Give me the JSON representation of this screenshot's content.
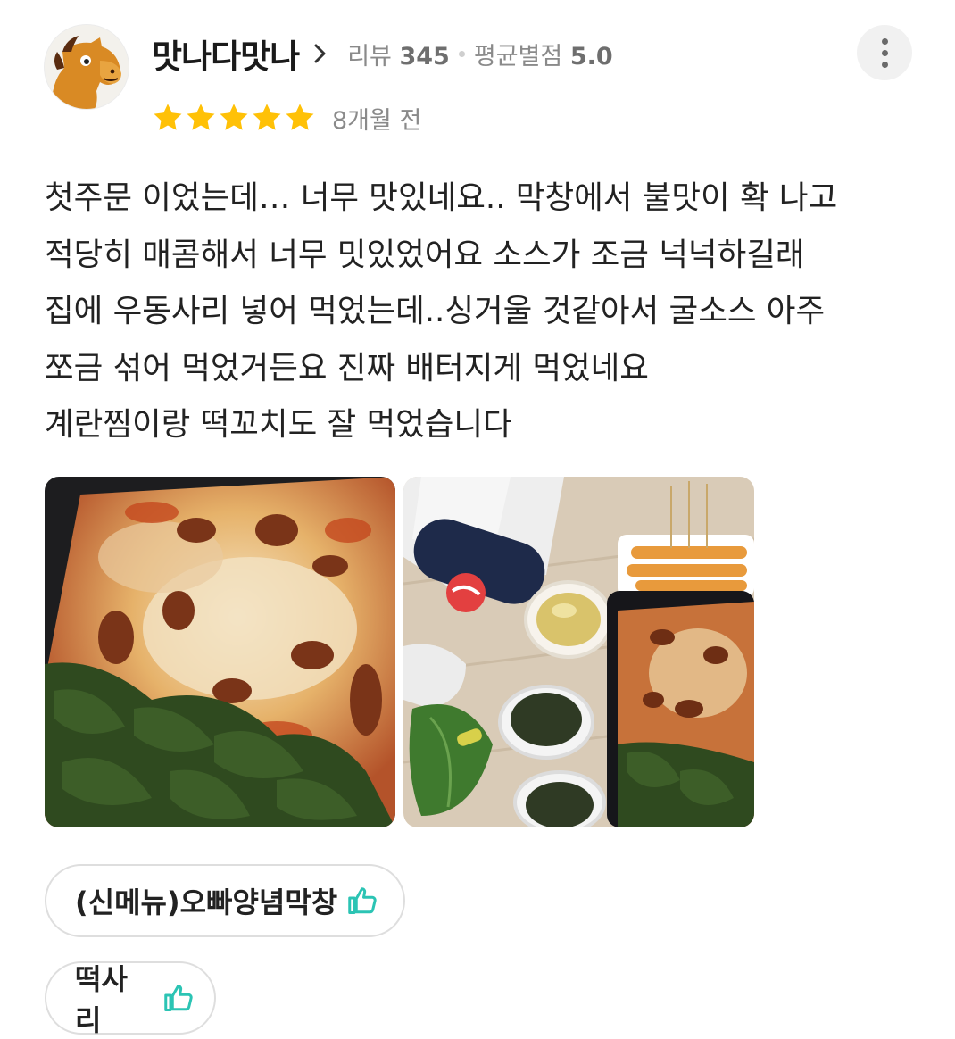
{
  "author": {
    "name": "맛나다맛나",
    "avatar_icon": "horse-avatar-icon",
    "review_count_label": "리뷰",
    "review_count": "345",
    "avg_rating_label": "평균별점",
    "avg_rating": "5.0"
  },
  "more_icon": "more-vertical-icon",
  "review": {
    "rating": 5,
    "max_rating": 5,
    "star_color": "#FFC107",
    "date": "8개월 전",
    "lines": [
      "첫주문 이었는데… 너무 맛있네요.. 막창에서 불맛이 확 나고",
      "적당히 매콤해서 너무 밋있었어요 소스가 조금 넉넉하길래",
      "집에 우동사리 넣어 먹었는데..싱거울 것같아서 굴소스 아주",
      "쪼금 섞어 먹었거든요 진짜 배터지게 먹었네요",
      "계란찜이랑 떡꼬치도 잘 먹었습니다"
    ]
  },
  "photos": [
    {
      "subject": "grilled-makchang-with-cheese-photo"
    },
    {
      "subject": "delivery-meal-spread-photo"
    }
  ],
  "menu_tags": [
    {
      "label": "(신메뉴)오빠양념막창",
      "icon": "thumbs-up-icon"
    },
    {
      "label": "떡사리",
      "icon": "thumbs-up-icon"
    }
  ],
  "colors": {
    "thumb_icon": "#2BC4B4",
    "meta_text": "#8A8A8A"
  }
}
